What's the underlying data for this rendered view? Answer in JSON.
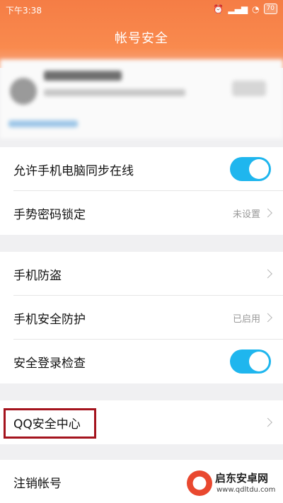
{
  "status_bar": {
    "time": "下午3:38",
    "battery": "70",
    "icons": [
      "alarm-icon",
      "signal-icon",
      "wifi-icon"
    ]
  },
  "header": {
    "title": "帐号安全"
  },
  "colors": {
    "header_orange": "#f57d45",
    "toggle_blue": "#1fb6ee",
    "highlight_red": "#a4131d"
  },
  "settings": {
    "sync_online": {
      "label": "允许手机电脑同步在线",
      "toggle_on": true
    },
    "gesture_lock": {
      "label": "手势密码锁定",
      "value": "未设置"
    },
    "anti_theft": {
      "label": "手机防盗"
    },
    "security_protection": {
      "label": "手机安全防护",
      "value": "已启用"
    },
    "safe_login_check": {
      "label": "安全登录检查",
      "toggle_on": true
    },
    "qq_security_center": {
      "label": "QQ安全中心"
    },
    "cancel_account": {
      "label": "注销帐号"
    }
  },
  "watermark": {
    "name": "启东安卓网",
    "url": "www.qdltdu.com"
  }
}
